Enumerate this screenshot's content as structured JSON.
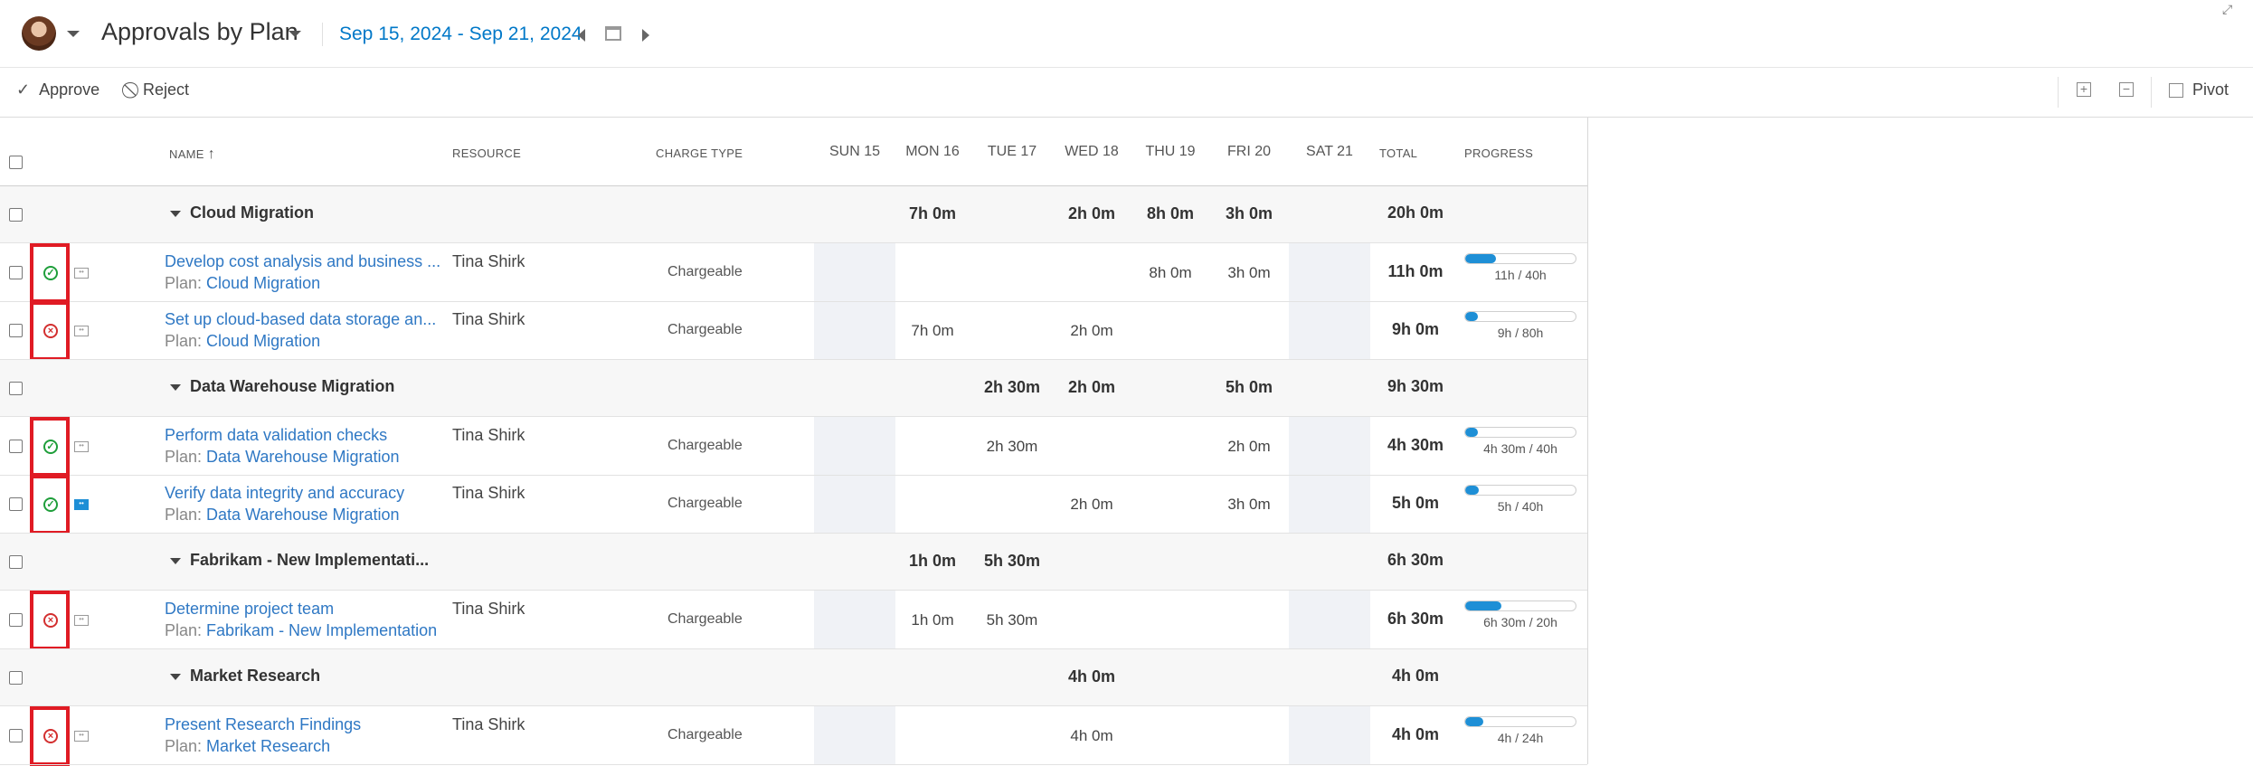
{
  "header": {
    "title": "Approvals by Plan",
    "date_range": "Sep 15, 2024 - Sep 21, 2024"
  },
  "toolbar": {
    "approve": "Approve",
    "reject": "Reject",
    "expand_all": "+",
    "collapse_all": "−",
    "pivot": "Pivot"
  },
  "columns": {
    "name": "NAME",
    "resource": "RESOURCE",
    "charge_type": "CHARGE TYPE",
    "days": [
      "SUN 15",
      "MON 16",
      "TUE 17",
      "WED 18",
      "THU 19",
      "FRI 20",
      "SAT 21"
    ],
    "total": "TOTAL",
    "progress": "PROGRESS"
  },
  "groups": [
    {
      "name": "Cloud Migration",
      "days": [
        "",
        "7h 0m",
        "",
        "2h 0m",
        "8h 0m",
        "3h 0m",
        ""
      ],
      "total": "20h 0m",
      "tasks": [
        {
          "name": "Develop cost analysis and business ...",
          "plan_prefix": "Plan:",
          "plan": "Cloud Migration",
          "resource": "Tina Shirk",
          "charge": "Chargeable",
          "status": "approved",
          "days": [
            "",
            "",
            "",
            "",
            "8h 0m",
            "3h 0m",
            ""
          ],
          "total": "11h 0m",
          "progress": 0.275,
          "progress_label": "11h / 40h"
        },
        {
          "name": "Set up cloud-based data storage an...",
          "plan_prefix": "Plan:",
          "plan": "Cloud Migration",
          "resource": "Tina Shirk",
          "charge": "Chargeable",
          "status": "rejected",
          "days": [
            "",
            "7h 0m",
            "",
            "2h 0m",
            "",
            "",
            ""
          ],
          "total": "9h 0m",
          "progress": 0.1125,
          "progress_label": "9h / 80h"
        }
      ]
    },
    {
      "name": "Data Warehouse Migration",
      "days": [
        "",
        "",
        "2h 30m",
        "2h 0m",
        "",
        "5h 0m",
        ""
      ],
      "total": "9h 30m",
      "tasks": [
        {
          "name": "Perform data validation checks",
          "plan_prefix": "Plan:",
          "plan": "Data Warehouse Migration",
          "resource": "Tina Shirk",
          "charge": "Chargeable",
          "status": "approved",
          "days": [
            "",
            "",
            "2h 30m",
            "",
            "",
            "2h 0m",
            ""
          ],
          "total": "4h 30m",
          "progress": 0.1125,
          "progress_label": "4h 30m / 40h"
        },
        {
          "name": "Verify data integrity and accuracy",
          "plan_prefix": "Plan:",
          "plan": "Data Warehouse Migration",
          "resource": "Tina Shirk",
          "charge": "Chargeable",
          "status": "approved",
          "note_filled": true,
          "days": [
            "",
            "",
            "",
            "2h 0m",
            "",
            "3h 0m",
            ""
          ],
          "total": "5h 0m",
          "progress": 0.125,
          "progress_label": "5h / 40h"
        }
      ]
    },
    {
      "name": "Fabrikam - New Implementati...",
      "days": [
        "",
        "1h 0m",
        "5h 30m",
        "",
        "",
        "",
        ""
      ],
      "total": "6h 30m",
      "tasks": [
        {
          "name": "Determine project team",
          "plan_prefix": "Plan:",
          "plan": "Fabrikam - New Implementation",
          "resource": "Tina Shirk",
          "charge": "Chargeable",
          "status": "rejected",
          "days": [
            "",
            "1h 0m",
            "5h 30m",
            "",
            "",
            "",
            ""
          ],
          "total": "6h 30m",
          "progress": 0.325,
          "progress_label": "6h 30m / 20h"
        }
      ]
    },
    {
      "name": "Market Research",
      "days": [
        "",
        "",
        "",
        "4h 0m",
        "",
        "",
        ""
      ],
      "total": "4h 0m",
      "tasks": [
        {
          "name": "Present Research Findings",
          "plan_prefix": "Plan:",
          "plan": "Market Research",
          "resource": "Tina Shirk",
          "charge": "Chargeable",
          "status": "rejected",
          "days": [
            "",
            "",
            "",
            "4h 0m",
            "",
            "",
            ""
          ],
          "total": "4h 0m",
          "progress": 0.1667,
          "progress_label": "4h / 24h"
        }
      ]
    }
  ],
  "colors": {
    "accent": "#0078c8",
    "link": "#2f78c4",
    "approved": "#1e9e3a",
    "rejected": "#d32f2f",
    "highlight_box": "#e01b24",
    "progress_fill": "#1e8fd6"
  }
}
